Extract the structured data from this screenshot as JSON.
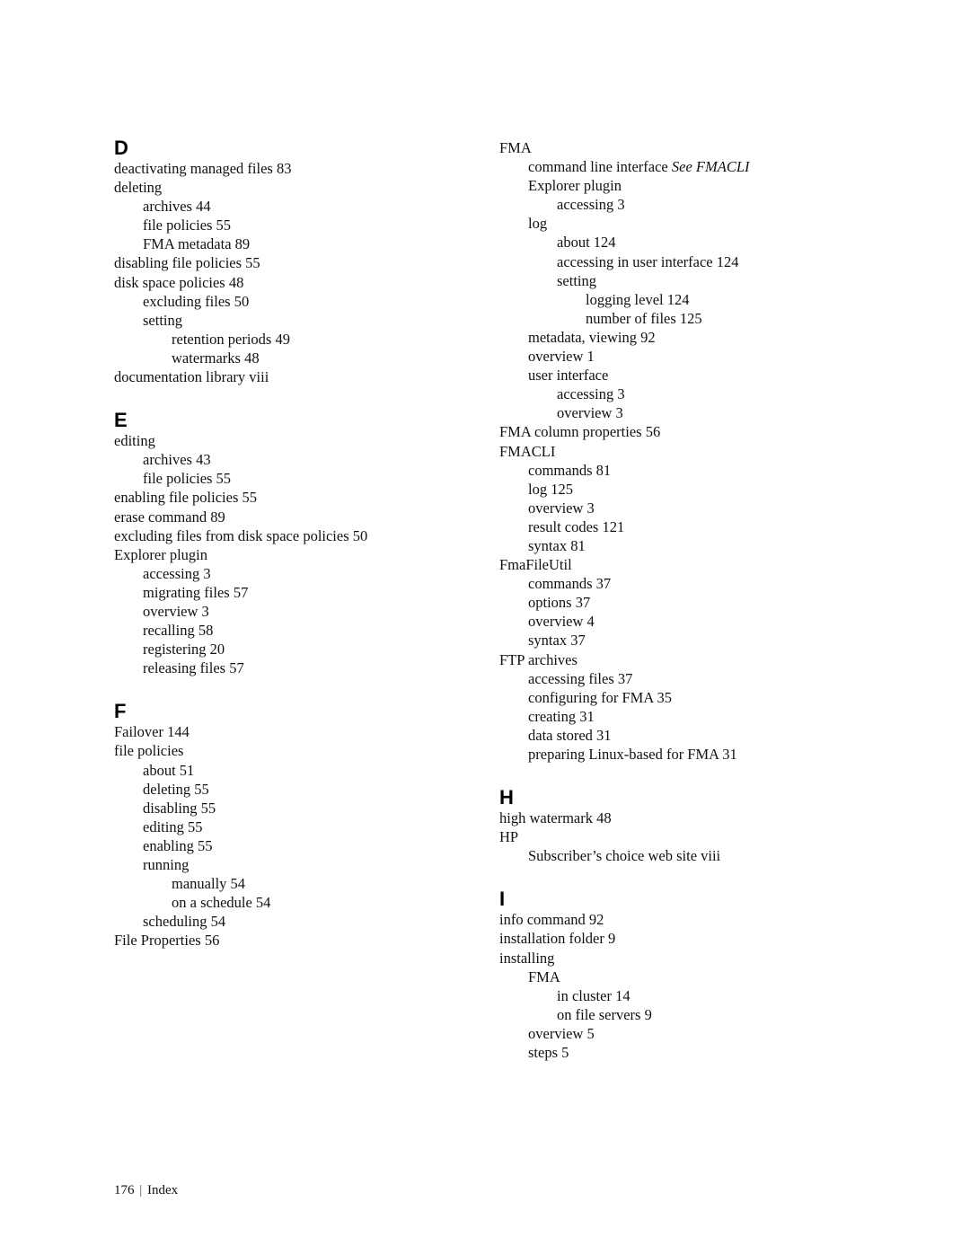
{
  "index": {
    "left_column": [
      {
        "letter": "D",
        "entries": [
          {
            "level": 1,
            "text": "deactivating managed files 83"
          },
          {
            "level": 1,
            "text": "deleting"
          },
          {
            "level": 2,
            "text": "archives 44"
          },
          {
            "level": 2,
            "text": "file policies 55"
          },
          {
            "level": 2,
            "text": "FMA metadata 89"
          },
          {
            "level": 1,
            "text": "disabling file policies 55"
          },
          {
            "level": 1,
            "text": "disk space policies 48"
          },
          {
            "level": 2,
            "text": "excluding files 50"
          },
          {
            "level": 2,
            "text": "setting"
          },
          {
            "level": 3,
            "text": "retention periods 49"
          },
          {
            "level": 3,
            "text": "watermarks 48"
          },
          {
            "level": 1,
            "text": "documentation library viii"
          }
        ]
      },
      {
        "letter": "E",
        "entries": [
          {
            "level": 1,
            "text": "editing"
          },
          {
            "level": 2,
            "text": "archives 43"
          },
          {
            "level": 2,
            "text": "file policies 55"
          },
          {
            "level": 1,
            "text": "enabling file policies 55"
          },
          {
            "level": 1,
            "text": "erase command 89"
          },
          {
            "level": 1,
            "text": "excluding files from disk space policies 50"
          },
          {
            "level": 1,
            "text": "Explorer plugin"
          },
          {
            "level": 2,
            "text": "accessing 3"
          },
          {
            "level": 2,
            "text": "migrating files 57"
          },
          {
            "level": 2,
            "text": "overview 3"
          },
          {
            "level": 2,
            "text": "recalling 58"
          },
          {
            "level": 2,
            "text": "registering 20"
          },
          {
            "level": 2,
            "text": "releasing files 57"
          }
        ]
      },
      {
        "letter": "F",
        "entries": [
          {
            "level": 1,
            "text": "Failover 144"
          },
          {
            "level": 1,
            "text": "file policies"
          },
          {
            "level": 2,
            "text": "about 51"
          },
          {
            "level": 2,
            "text": "deleting 55"
          },
          {
            "level": 2,
            "text": "disabling 55"
          },
          {
            "level": 2,
            "text": "editing 55"
          },
          {
            "level": 2,
            "text": "enabling 55"
          },
          {
            "level": 2,
            "text": "running"
          },
          {
            "level": 3,
            "text": "manually 54"
          },
          {
            "level": 3,
            "text": "on a schedule 54"
          },
          {
            "level": 2,
            "text": "scheduling 54"
          },
          {
            "level": 1,
            "text": "File Properties 56"
          }
        ]
      }
    ],
    "right_column": [
      {
        "letter": "",
        "entries": [
          {
            "level": 1,
            "text": "FMA"
          },
          {
            "level": 2,
            "text": "command line interface ",
            "see": "See FMACLI"
          },
          {
            "level": 2,
            "text": "Explorer plugin"
          },
          {
            "level": 3,
            "text": "accessing 3"
          },
          {
            "level": 2,
            "text": "log"
          },
          {
            "level": 3,
            "text": "about 124"
          },
          {
            "level": 3,
            "text": "accessing in user interface 124"
          },
          {
            "level": 3,
            "text": "setting"
          },
          {
            "level": 4,
            "text": "logging level 124"
          },
          {
            "level": 4,
            "text": "number of files 125"
          },
          {
            "level": 2,
            "text": "metadata, viewing 92"
          },
          {
            "level": 2,
            "text": "overview 1"
          },
          {
            "level": 2,
            "text": "user interface"
          },
          {
            "level": 3,
            "text": "accessing 3"
          },
          {
            "level": 3,
            "text": "overview 3"
          },
          {
            "level": 1,
            "text": "FMA column properties 56"
          },
          {
            "level": 1,
            "text": "FMACLI"
          },
          {
            "level": 2,
            "text": "commands 81"
          },
          {
            "level": 2,
            "text": "log 125"
          },
          {
            "level": 2,
            "text": "overview 3"
          },
          {
            "level": 2,
            "text": "result codes 121"
          },
          {
            "level": 2,
            "text": "syntax 81"
          },
          {
            "level": 1,
            "text": "FmaFileUtil"
          },
          {
            "level": 2,
            "text": "commands 37"
          },
          {
            "level": 2,
            "text": "options 37"
          },
          {
            "level": 2,
            "text": "overview 4"
          },
          {
            "level": 2,
            "text": "syntax 37"
          },
          {
            "level": 1,
            "text": "FTP archives"
          },
          {
            "level": 2,
            "text": "accessing files 37"
          },
          {
            "level": 2,
            "text": "configuring for FMA 35"
          },
          {
            "level": 2,
            "text": "creating 31"
          },
          {
            "level": 2,
            "text": "data stored 31"
          },
          {
            "level": 2,
            "text": "preparing Linux-based for FMA 31"
          }
        ]
      },
      {
        "letter": "H",
        "entries": [
          {
            "level": 1,
            "text": "high watermark 48"
          },
          {
            "level": 1,
            "text": "HP"
          },
          {
            "level": 2,
            "text": "Subscriber’s choice web site viii"
          }
        ]
      },
      {
        "letter": "I",
        "entries": [
          {
            "level": 1,
            "text": "info command 92"
          },
          {
            "level": 1,
            "text": "installation folder 9"
          },
          {
            "level": 1,
            "text": "installing"
          },
          {
            "level": 2,
            "text": "FMA"
          },
          {
            "level": 3,
            "text": "in cluster 14"
          },
          {
            "level": 3,
            "text": "on file servers 9"
          },
          {
            "level": 2,
            "text": "overview 5"
          },
          {
            "level": 2,
            "text": "steps 5"
          }
        ]
      }
    ]
  },
  "footer": {
    "page_number": "176",
    "separator": "|",
    "section": "Index"
  }
}
